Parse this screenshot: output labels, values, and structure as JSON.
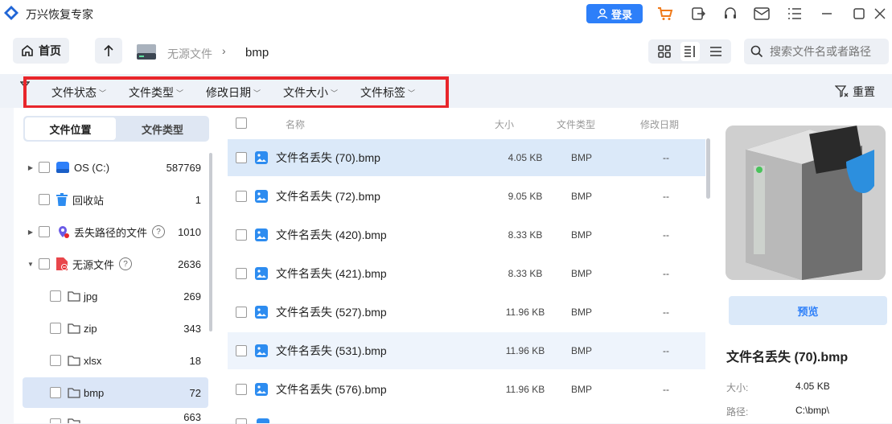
{
  "app": {
    "title": "万兴恢复专家",
    "login_label": "登录"
  },
  "titlebar_icons": [
    "cart-icon",
    "export-icon",
    "headset-icon",
    "mail-icon",
    "menu-icon",
    "minimize-icon",
    "maximize-icon",
    "close-icon"
  ],
  "nav": {
    "home_label": "首页",
    "breadcrumb": [
      "无源文件",
      "bmp"
    ],
    "search_placeholder": "搜索文件名或者路径"
  },
  "filters": {
    "items": [
      "文件状态",
      "文件类型",
      "修改日期",
      "文件大小",
      "文件标签"
    ],
    "reset_label": "重置"
  },
  "sidebar": {
    "tabs": [
      "文件位置",
      "文件类型"
    ],
    "active_tab": "文件位置",
    "items": [
      {
        "label": "OS (C:)",
        "count": "587769"
      },
      {
        "label": "回收站",
        "count": "1"
      },
      {
        "label": "丢失路径的文件",
        "count": "1010"
      },
      {
        "label": "无源文件",
        "count": "2636"
      },
      {
        "label": "jpg",
        "count": "269"
      },
      {
        "label": "zip",
        "count": "343"
      },
      {
        "label": "xlsx",
        "count": "18"
      },
      {
        "label": "bmp",
        "count": "72"
      },
      {
        "label": "",
        "count": "663"
      }
    ]
  },
  "list": {
    "headers": {
      "name": "名称",
      "size": "大小",
      "type": "文件类型",
      "date": "修改日期"
    },
    "rows": [
      {
        "name": "文件名丢失 (70).bmp",
        "size": "4.05 KB",
        "type": "BMP",
        "date": "--"
      },
      {
        "name": "文件名丢失 (72).bmp",
        "size": "9.05 KB",
        "type": "BMP",
        "date": "--"
      },
      {
        "name": "文件名丢失 (420).bmp",
        "size": "8.33 KB",
        "type": "BMP",
        "date": "--"
      },
      {
        "name": "文件名丢失 (421).bmp",
        "size": "8.33 KB",
        "type": "BMP",
        "date": "--"
      },
      {
        "name": "文件名丢失 (527).bmp",
        "size": "11.96 KB",
        "type": "BMP",
        "date": "--"
      },
      {
        "name": "文件名丢失 (531).bmp",
        "size": "11.96 KB",
        "type": "BMP",
        "date": "--"
      },
      {
        "name": "文件名丢失 (576).bmp",
        "size": "11.96 KB",
        "type": "BMP",
        "date": "--"
      }
    ]
  },
  "detail": {
    "preview_label": "预览",
    "file_name": "文件名丢失 (70).bmp",
    "size_key": "大小:",
    "size_value": "4.05 KB",
    "path_key": "路径:",
    "path_value": "C:\\bmp\\"
  },
  "colors": {
    "accent": "#2d7ff9",
    "highlight_border": "#e8262b",
    "selected_row": "#dbe9f9"
  }
}
